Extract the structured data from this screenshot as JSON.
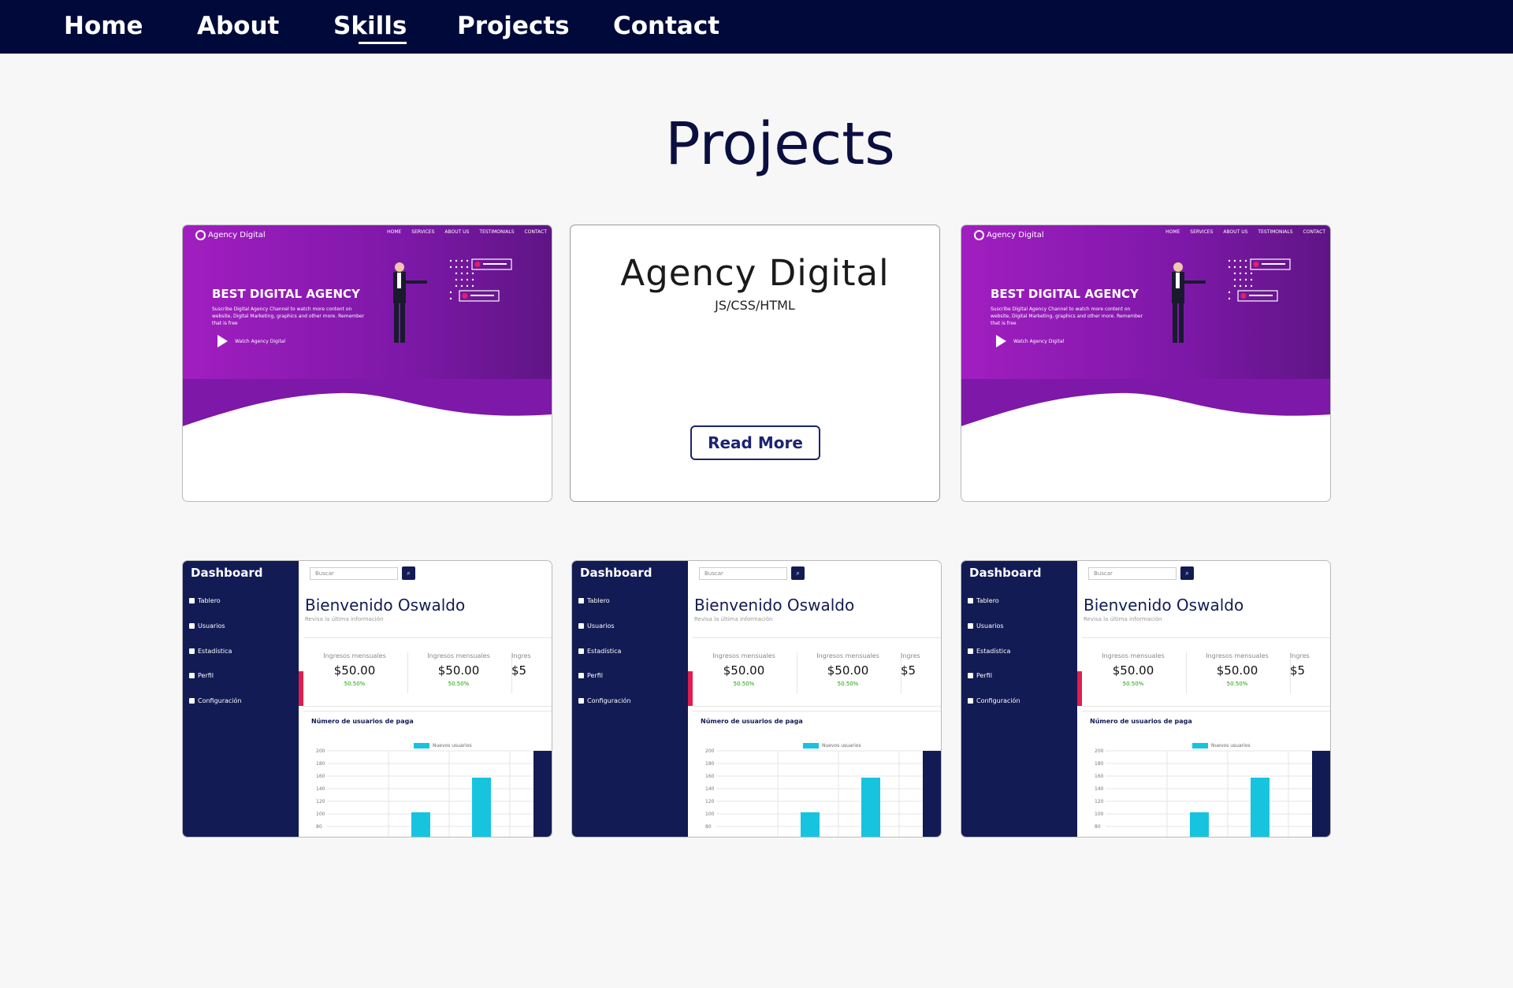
{
  "nav": {
    "items": [
      {
        "label": "Home"
      },
      {
        "label": "About"
      },
      {
        "label": "Skills"
      },
      {
        "label": "Projects"
      },
      {
        "label": "Contact"
      }
    ]
  },
  "page_title": "Projects",
  "colors": {
    "nav_bg": "#000a3a",
    "accent_navy": "#1b2470",
    "agency_purple": "#a11ec0",
    "dashboard_navy": "#121b54",
    "chart_cyan": "#17c4e0"
  },
  "agency_thumb": {
    "logo": "Agency Digital",
    "menu": [
      "HOME",
      "SERVICES",
      "ABOUT US",
      "TESTIMONIALS",
      "CONTACT"
    ],
    "headline": "BEST DIGITAL AGENCY",
    "text": "Suscribe Digital Agency Channel to watch more content on website, Digital Marketing, graphics and other more. Remember that is free",
    "watch": "Watch Agency Digital"
  },
  "info_card": {
    "title": "Agency Digital",
    "tech": "JS/CSS/HTML",
    "button": "Read More"
  },
  "dashboard_thumb": {
    "brand": "Dashboard",
    "menu": [
      "Tablero",
      "Usuarios",
      "Estadística",
      "Perfil",
      "Configuración"
    ],
    "search_placeholder": "Buscar",
    "greeting": "Bienvenido Oswaldo",
    "hint": "Revisa la última información",
    "stats": [
      {
        "label": "Ingresos mensuales",
        "value": "$50.00",
        "change": "50.50%"
      },
      {
        "label": "Ingresos mensuales",
        "value": "$50.00",
        "change": "50.50%"
      },
      {
        "label": "Ingres",
        "value": "$5",
        "change": ""
      }
    ],
    "chart_title": "Número de usuarios de paga",
    "legend": "Nuevos usuarios",
    "y_ticks": [
      "200",
      "180",
      "160",
      "140",
      "120",
      "100",
      "80"
    ]
  },
  "cards_row1": [
    "agency",
    "info",
    "agency"
  ],
  "cards_row2": [
    "dashboard",
    "dashboard",
    "dashboard"
  ]
}
